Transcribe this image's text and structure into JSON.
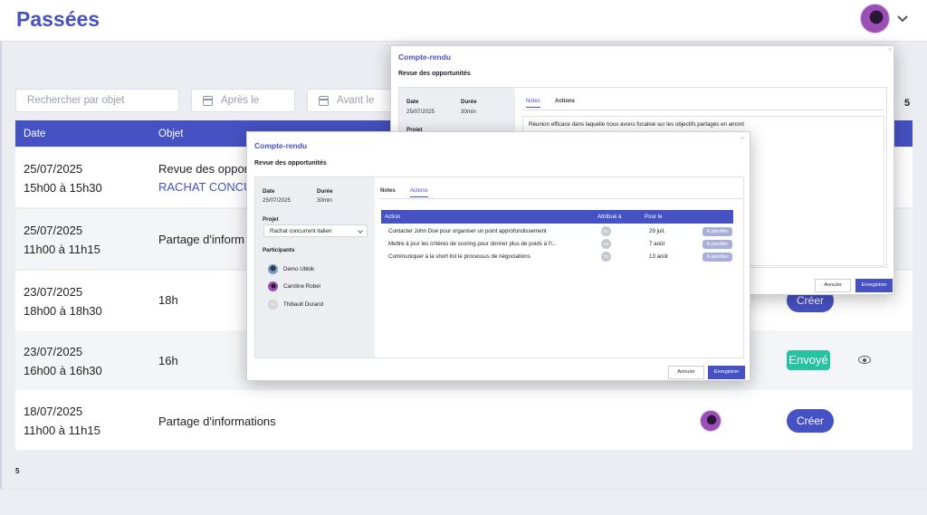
{
  "header": {
    "title": "Passées"
  },
  "filters": {
    "search_placeholder": "Rechercher par objet",
    "after_placeholder": "Après le",
    "before_placeholder": "Avant le"
  },
  "count_top": "5",
  "count_bottom": "5",
  "table": {
    "columns": [
      "Date",
      "Objet"
    ],
    "rows": [
      {
        "date": "25/07/2025",
        "time": "15h00 à 15h30",
        "objet": "Revue des oppor",
        "objet_sub": "RACHAT CONCU"
      },
      {
        "date": "25/07/2025",
        "time": "11h00 à 11h15",
        "objet": "Partage d'inform"
      },
      {
        "date": "23/07/2025",
        "time": "18h00 à 18h30",
        "objet": "18h",
        "action": "Créer"
      },
      {
        "date": "23/07/2025",
        "time": "16h00 à 16h30",
        "objet": "16h",
        "action": "Envoyé"
      },
      {
        "date": "18/07/2025",
        "time": "11h00 à 11h15",
        "objet": "Partage d'informations",
        "action": "Créer"
      }
    ]
  },
  "modal_back": {
    "title": "Compte-rendu",
    "subtitle": "Revue des opportunités",
    "date_label": "Date",
    "date_value": "25/07/2025",
    "duration_label": "Durée",
    "duration_value": "30min",
    "project_label": "Projet",
    "tabs": [
      "Notes",
      "Actions"
    ],
    "note_text": "Réunion efficace dans laquelle nous avons focalisé sur les objectifs partagés en amont",
    "cancel": "Annuler",
    "save": "Enregistrer"
  },
  "modal_front": {
    "title": "Compte-rendu",
    "subtitle": "Revue des opportunités",
    "date_label": "Date",
    "date_value": "25/07/2025",
    "duration_label": "Durée",
    "duration_value": "30min",
    "project_label": "Projet",
    "project_value": "Rachat concurrent italien",
    "participants_label": "Participants",
    "participants": [
      "Demo Ubbik",
      "Caroline Robel",
      "Thibault Durand"
    ],
    "tabs": [
      "Notes",
      "Actions"
    ],
    "actions_columns": [
      "Action",
      "Attribué à",
      "Pour le"
    ],
    "actions": [
      {
        "action": "Contacter John Doe pour organiser un point approfondissement",
        "assignee": "DU",
        "due": "29 juil.",
        "status": "A planifier"
      },
      {
        "action": "Mettre à jour les critères de scoring pour donner plus de poids à l'i...",
        "assignee": "CR",
        "due": "7 août",
        "status": "A planifier"
      },
      {
        "action": "Communiquer à la short list le processus de négociations",
        "assignee": "TD",
        "due": "13 août",
        "status": "A planifier"
      }
    ],
    "cancel": "Annuler",
    "save": "Enregistrer"
  },
  "colors": {
    "accent": "#4651c3",
    "success": "#27c2a4",
    "pill": "#a9aeda"
  }
}
